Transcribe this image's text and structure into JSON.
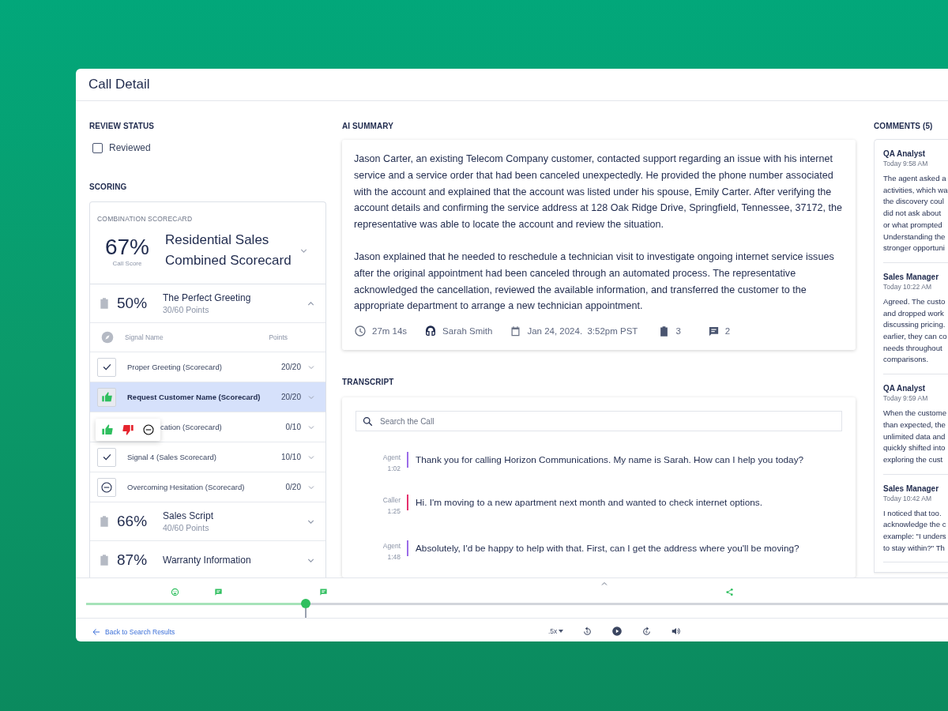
{
  "window": {
    "title": "Call Detail"
  },
  "review_status": {
    "label": "REVIEW STATUS",
    "checkbox": {
      "label": "Reviewed",
      "checked": false
    }
  },
  "scoring": {
    "label": "SCORING",
    "combination": {
      "label": "COMBINATION SCORECARD",
      "score": "67%",
      "score_label": "Call Score",
      "name": "Residential Sales Combined Scorecard",
      "expanded": false
    },
    "sections": [
      {
        "percent": "50%",
        "name": "The Perfect Greeting",
        "points": "30/60 Points",
        "expanded": true,
        "columns": [
          "Signal Name",
          "Points"
        ],
        "signals": [
          {
            "kind": "pass",
            "name": "Proper Greeting (Scorecard)",
            "points": "20/20",
            "selected": false
          },
          {
            "kind": "thumbs_up",
            "name": "Request Customer Name (Scorecard)",
            "points": "20/20",
            "selected": true
          },
          {
            "kind": "picker",
            "name": "cation (Scorecard)",
            "points": "0/10",
            "selected": false
          },
          {
            "kind": "pass",
            "name": "Signal 4 (Sales Scorecard)",
            "points": "10/10",
            "selected": false
          },
          {
            "kind": "neutral",
            "name": "Overcoming Hesitation (Scorecard)",
            "points": "0/20",
            "selected": false
          }
        ]
      },
      {
        "percent": "66%",
        "name": "Sales Script",
        "points": "40/60 Points",
        "expanded": false
      },
      {
        "percent": "87%",
        "name": "Warranty Information",
        "expanded": false
      }
    ]
  },
  "ai_summary": {
    "label": "AI SUMMARY",
    "paragraphs": [
      "Jason Carter, an existing Telecom Company customer, contacted support regarding an issue with his internet service and a service order that had been canceled unexpectedly. He provided the phone number associated with the account and explained that the account was listed under his spouse, Emily Carter. After verifying the account details and confirming the service address at 128 Oak Ridge Drive, Springfield, Tennessee, 37172, the representative was able to locate the account and review the situation.",
      "Jason explained that he needed to reschedule a technician visit to investigate ongoing internet service issues after the original appointment had been canceled through an automated process. The representative acknowledged the cancellation, reviewed the available information, and transferred the customer to the appropriate department to arrange a new technician appointment."
    ],
    "meta": [
      {
        "kind": "duration",
        "text": "27m 14s"
      },
      {
        "kind": "agent",
        "text": "Sarah Smith"
      },
      {
        "kind": "date",
        "text": "Jan 24, 2024.  3:52pm PST"
      },
      {
        "kind": "tasks",
        "text": "3"
      },
      {
        "kind": "comments",
        "text": "2"
      }
    ]
  },
  "transcript": {
    "label": "TRANSCRIPT",
    "search": {
      "placeholder": "Search the Call"
    },
    "entries": [
      {
        "speaker": "Agent",
        "time": "1:02",
        "kind": "agent",
        "text": "Thank you for calling Horizon Communications. My name is Sarah. How can I help you today?"
      },
      {
        "speaker": "Caller",
        "time": "1:25",
        "kind": "caller",
        "text": "Hi. I'm moving to a new apartment next month and wanted to check internet options."
      },
      {
        "speaker": "Agent",
        "time": "1:48",
        "kind": "agent",
        "text": "Absolutely, I'd be happy to help with that. First, can I get the address where you'll be moving?"
      }
    ]
  },
  "comments": {
    "label": "COMMENTS (5)",
    "items": [
      {
        "author": "QA Analyst",
        "time": "Today 9:58 AM",
        "lines": [
          "The agent asked a",
          "activities, which wa",
          "the discovery coul",
          "did not ask about",
          "or what prompted",
          "Understanding the",
          "stronger opportuni"
        ]
      },
      {
        "author": "Sales Manager",
        "time": "Today 10:22 AM",
        "lines": [
          "Agreed. The custo",
          "and dropped work",
          "discussing pricing.",
          "earlier, they can co",
          "needs throughout",
          "comparisons."
        ]
      },
      {
        "author": "QA Analyst",
        "time": "Today 9:59 AM",
        "lines": [
          "When the custome",
          "than expected, the",
          "unlimited data and",
          "quickly shifted into",
          "exploring the cust"
        ]
      },
      {
        "author": "Sales Manager",
        "time": "Today 10:42 AM",
        "lines": [
          "I noticed that too.",
          "acknowledge the c",
          "example: \"I unders",
          "to stay within?\" Th"
        ]
      }
    ]
  },
  "player": {
    "level": 0.255,
    "back_link": "Back to Search Results",
    "speed": ".5x"
  }
}
